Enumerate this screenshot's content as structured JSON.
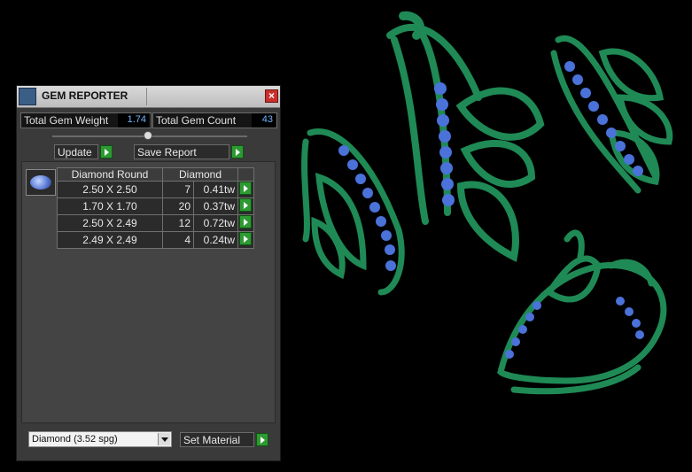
{
  "window": {
    "title": "GEM REPORTER",
    "close_label": "×"
  },
  "stats": {
    "weight_label": "Total Gem Weight",
    "weight_value": "1.74",
    "count_label": "Total Gem Count",
    "count_value": "43"
  },
  "toolbar": {
    "update_label": "Update",
    "save_label": "Save Report"
  },
  "gem_table": {
    "headers": [
      "Diamond Round",
      "Diamond"
    ],
    "rows": [
      {
        "size": "2.50 X 2.50",
        "qty": "7",
        "tw": "0.41tw"
      },
      {
        "size": "1.70 X 1.70",
        "qty": "20",
        "tw": "0.37tw"
      },
      {
        "size": "2.50 X 2.49",
        "qty": "12",
        "tw": "0.72tw"
      },
      {
        "size": "2.49 X 2.49",
        "qty": "4",
        "tw": "0.24tw"
      }
    ]
  },
  "material": {
    "selected": "Diamond    (3.52 spg)",
    "set_label": "Set Material"
  },
  "colors": {
    "metal": "#1e8a55",
    "gem": "#4a72d9",
    "panel": "#3a3a3a",
    "value_text": "#6fb7ff"
  }
}
